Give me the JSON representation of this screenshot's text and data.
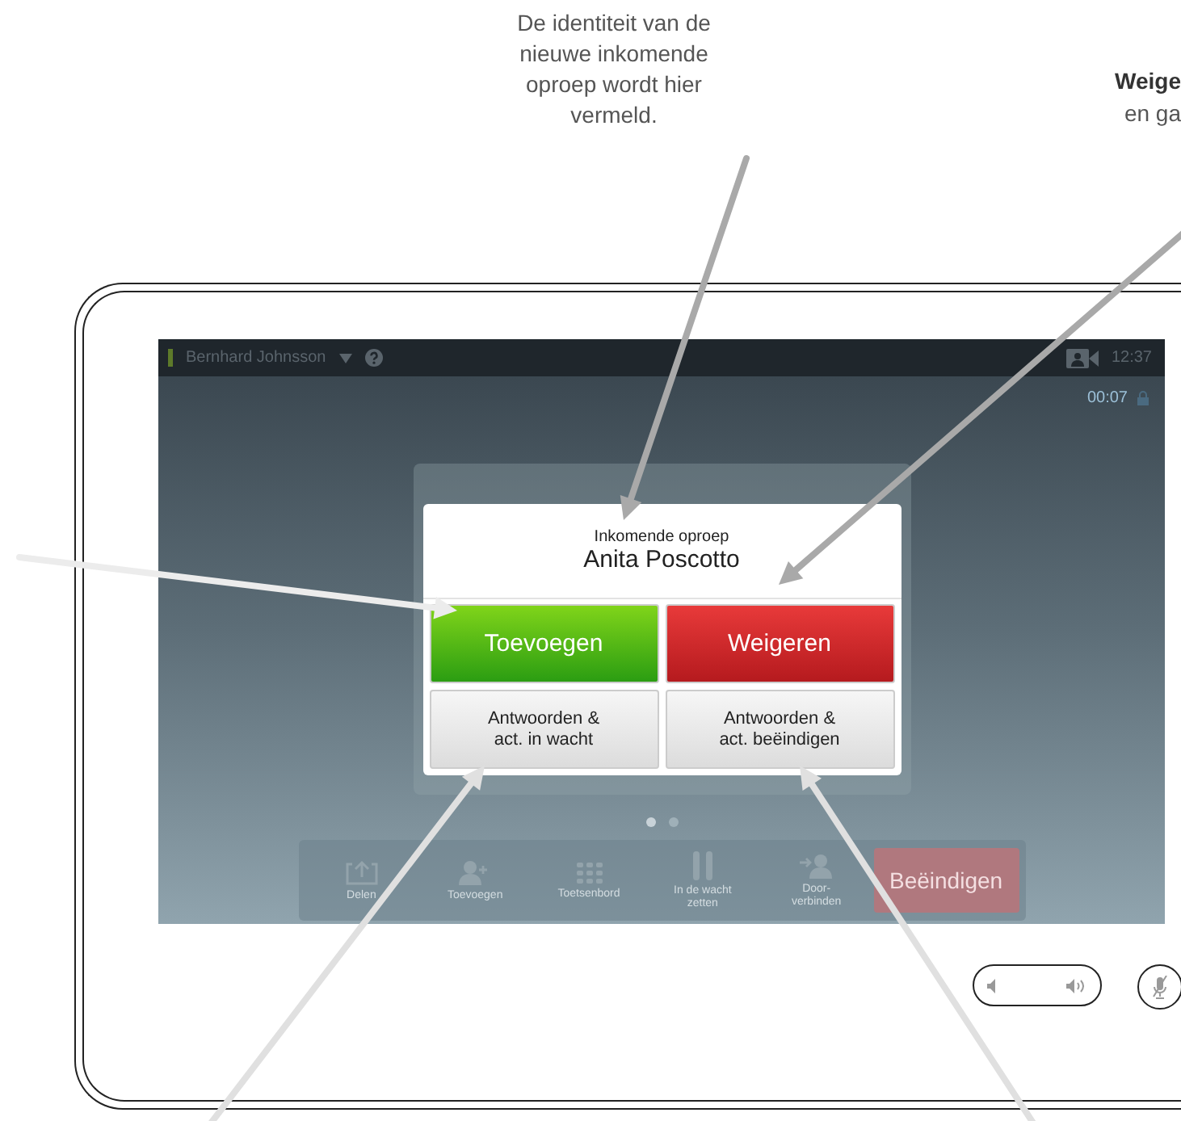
{
  "callouts": [
    {
      "kind": "plain",
      "text": "De identiteit van de nieuwe inkomende oproep wordt hier vermeld."
    },
    {
      "kind": "bold-lead",
      "title": "Weige",
      "text": "en ga"
    }
  ],
  "top_bar": {
    "user": "Bernhard Johnsson",
    "time": "12:37"
  },
  "call_timer": "00:07",
  "dialog": {
    "heading": "Inkomende oproep",
    "caller": "Anita Poscotto",
    "buttons": [
      {
        "label": "Toevoegen",
        "kind": "accept"
      },
      {
        "label": "Weigeren",
        "kind": "decline"
      },
      {
        "label": "Antwoorden &\nact. in wacht",
        "kind": "secondary"
      },
      {
        "label": "Antwoorden &\nact. beëindigen",
        "kind": "secondary"
      }
    ]
  },
  "page_dots": [
    {
      "selected": true
    },
    {
      "selected": false
    }
  ],
  "toolbar": [
    {
      "label": "Delen",
      "kind": "share"
    },
    {
      "label": "Toevoegen",
      "kind": "add"
    },
    {
      "label": "Toetsenbord",
      "kind": "keypad"
    },
    {
      "label": "In de wacht\nzetten",
      "kind": "hold"
    },
    {
      "label": "Door-\nverbinden",
      "kind": "transfer"
    },
    {
      "label": "Beëindigen",
      "kind": "end"
    }
  ]
}
